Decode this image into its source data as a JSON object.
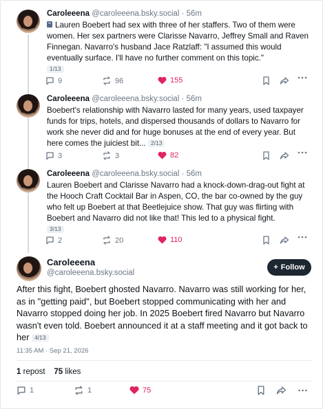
{
  "posts": [
    {
      "author": "Caroleeena",
      "handle": "@caroleeena.bsky.social · 56m",
      "text": "Lauren Boebert had sex with three of her staffers. Two of them were women. Her sex partners were Clarisse Navarro, Jeffrey Small and Raven Finnegan. Navarro's husband Jace Ratzlaff: \"I assumed this would eventually surface. I'll have no further comment on this topic.\"",
      "badge": "1/13",
      "replies": "9",
      "reposts": "96",
      "likes": "155"
    },
    {
      "author": "Caroleeena",
      "handle": "@caroleeena.bsky.social · 56m",
      "text": "Boebert's relationship with Navarro lasted for many years, used taxpayer funds for trips, hotels, and dispersed thousands of dollars to Navarro for work she never did and for huge bonuses at the end of every year. But here comes the juiciest bit...",
      "badge": "2/13",
      "replies": "3",
      "reposts": "3",
      "likes": "82"
    },
    {
      "author": "Caroleeena",
      "handle": "@caroleeena.bsky.social · 56m",
      "text": "Lauren Boebert and Clarisse Navarro had a knock-down-drag-out fight at the Hooch Craft Cocktail Bar in Aspen, CO, the bar co-owned by the guy who felt up Boebert at that Beetlejuice show. That guy was flirting with Boebert and Navarro did not like that!  This led to a physical fight.",
      "badge": "3/13",
      "replies": "2",
      "reposts": "20",
      "likes": "110"
    }
  ],
  "main": {
    "author": "Caroleeena",
    "handle": "@caroleeena.bsky.social",
    "follow_label": "Follow",
    "text": "After this fight, Boebert ghosted Navarro. Navarro was still working for her, as in \"getting paid\", but Boebert stopped communicating with her and Navarro stopped doing her job. In 2025 Boebert fired Navarro but Navarro wasn't even told. Boebert announced it at a staff meeting and it got back to her",
    "badge": "4/13",
    "timestamp": "11:35 AM · Sep 21, 2026",
    "repost_count": "1",
    "repost_label": "repost",
    "like_count": "75",
    "like_label": "likes",
    "replies": "1",
    "reposts": "1",
    "likes": "75"
  },
  "colors": {
    "like": "#e0245e",
    "muted": "#6b7785",
    "button": "#1d2731"
  }
}
